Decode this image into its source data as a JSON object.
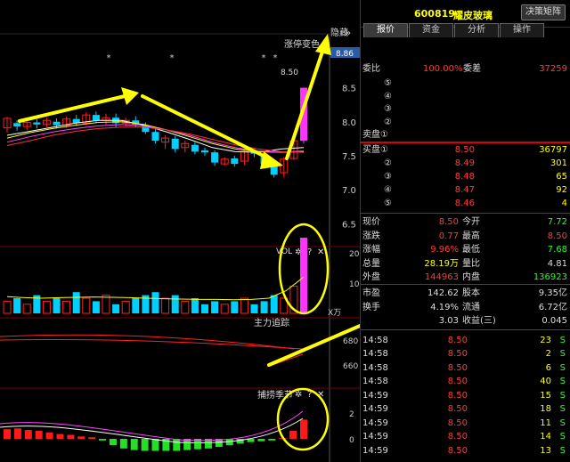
{
  "chart": {
    "limit_label": "涨停变色",
    "hide_label": "隐藏",
    "hide_icon": "double-chevron-right-icon",
    "price_badge": "8.86",
    "price_mark": "8.50",
    "star": "*",
    "y_ticks": [
      "8.5",
      "8.0",
      "7.5",
      "7.0",
      "6.5"
    ],
    "vol_title": "VOL",
    "vol_ticks": [
      "20",
      "10"
    ],
    "vol_unit": "X万",
    "main_title": "主力追踪",
    "main_ticks": [
      "680",
      "660"
    ],
    "catch_title": "捕捞季节",
    "catch_ticks": [
      "2",
      "0"
    ],
    "help_symbol": "?",
    "close_symbol": "✕",
    "gear_symbol": "✲",
    "colors": {
      "up": "#ff2020",
      "down": "#00d0ff",
      "ma_white": "#ffffff",
      "ma_yellow": "#ffff00",
      "ma_pink": "#ff44ff",
      "ma_red": "#ff3030",
      "limit_bar": "#ff33ff"
    }
  },
  "quote": {
    "code": "600819",
    "name": "耀皮玻璃",
    "decision_btn": "决策矩阵",
    "tabs": [
      "报价",
      "资金",
      "分析",
      "操作"
    ],
    "webi_label": "委比",
    "webi_value": "100.00%",
    "weicha_label": "委差",
    "weicha_value": "37259",
    "sell_label": "卖盘①",
    "sell_levels": [
      "⑤",
      "④",
      "③",
      "②"
    ],
    "buy_label": "买盘①",
    "buys": [
      {
        "lvl": "买盘①",
        "price": "8.50",
        "vol": "36797"
      },
      {
        "lvl": "②",
        "price": "8.49",
        "vol": "301"
      },
      {
        "lvl": "③",
        "price": "8.48",
        "vol": "65"
      },
      {
        "lvl": "④",
        "price": "8.47",
        "vol": "92"
      },
      {
        "lvl": "⑤",
        "price": "8.46",
        "vol": "4"
      }
    ],
    "stats": [
      {
        "l1": "现价",
        "v1": "8.50",
        "c1": "red",
        "l2": "今开",
        "v2": "7.72",
        "c2": "green"
      },
      {
        "l1": "涨跌",
        "v1": "0.77",
        "c1": "red",
        "l2": "最高",
        "v2": "8.50",
        "c2": "red"
      },
      {
        "l1": "涨幅",
        "v1": "9.96%",
        "c1": "red",
        "l2": "最低",
        "v2": "7.68",
        "c2": "green"
      },
      {
        "l1": "总量",
        "v1": "28.19万",
        "c1": "yel",
        "l2": "量比",
        "v2": "4.81",
        "c2": "wht"
      },
      {
        "l1": "外盘",
        "v1": "144963",
        "c1": "red",
        "l2": "内盘",
        "v2": "136923",
        "c2": "green"
      },
      {
        "l1": "市盈",
        "v1": "142.62",
        "c1": "wht",
        "l2": "股本",
        "v2": "9.35亿",
        "c2": "wht"
      },
      {
        "l1": "换手",
        "v1": "4.19%",
        "c1": "wht",
        "l2": "流通",
        "v2": "6.72亿",
        "c2": "wht"
      },
      {
        "l1": "",
        "v1": "3.03",
        "c1": "wht",
        "l2": "收益(三)",
        "v2": "0.045",
        "c2": "wht"
      }
    ],
    "ticks": [
      {
        "t": "14:58",
        "p": "8.50",
        "v": "23",
        "s": "S"
      },
      {
        "t": "14:58",
        "p": "8.50",
        "v": "2",
        "s": "S"
      },
      {
        "t": "14:58",
        "p": "8.50",
        "v": "6",
        "s": "S"
      },
      {
        "t": "14:58",
        "p": "8.50",
        "v": "40",
        "s": "S"
      },
      {
        "t": "14:59",
        "p": "8.50",
        "v": "15",
        "s": "S"
      },
      {
        "t": "14:59",
        "p": "8.50",
        "v": "18",
        "s": "S"
      },
      {
        "t": "14:59",
        "p": "8.50",
        "v": "11",
        "s": "S"
      },
      {
        "t": "14:59",
        "p": "8.50",
        "v": "14",
        "s": "S"
      },
      {
        "t": "14:59",
        "p": "8.50",
        "v": "13",
        "s": "S"
      }
    ]
  }
}
